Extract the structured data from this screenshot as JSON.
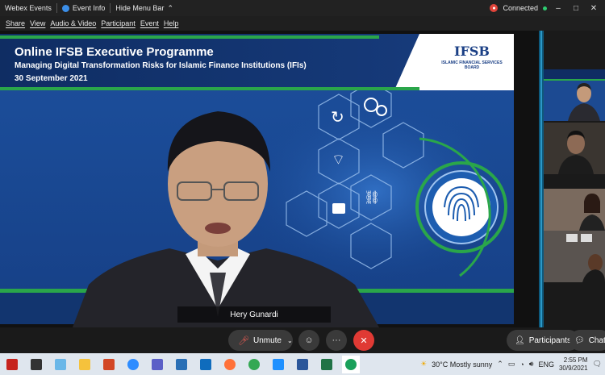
{
  "titlebar": {
    "app": "Webex Events",
    "event_info": "Event Info",
    "hide_menu": "Hide Menu Bar",
    "status": "Connected"
  },
  "menu": [
    "Share",
    "View",
    "Audio & Video",
    "Participant",
    "Event",
    "Help"
  ],
  "slide": {
    "title": "Online IFSB Executive Programme",
    "subtitle": "Managing Digital Transformation Risks for Islamic Finance Institutions (IFIs)",
    "date": "30 September 2021",
    "logo_mark": "IFSB",
    "logo_name": "ISLAMIC FINANCIAL SERVICES BOARD"
  },
  "speaker": {
    "name": "Hery Gunardi"
  },
  "controls": {
    "unmute": "Unmute",
    "participants": "Participants",
    "chat": "Chat"
  },
  "taskbar": {
    "weather": "30°C  Mostly sunny",
    "lang": "ENG",
    "time": "2:55 PM",
    "date": "30/9/2021"
  },
  "colors": {
    "slide_blue": "#1a4a95",
    "accent_green": "#2aa64a",
    "end_red": "#e03a34"
  }
}
